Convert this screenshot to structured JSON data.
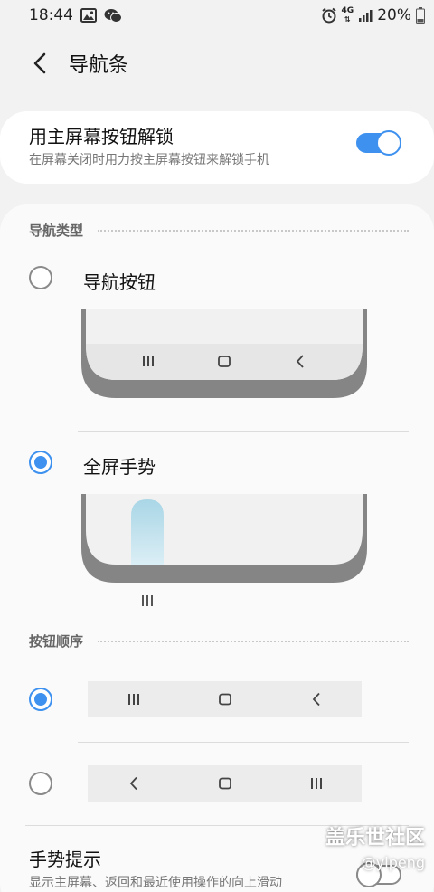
{
  "status_bar": {
    "time": "18:44",
    "network": "4G",
    "battery": "20%",
    "icons": [
      "image-icon",
      "wechat-icon",
      "alarm-icon",
      "network-4g-icon",
      "signal-icon",
      "battery-icon"
    ]
  },
  "header": {
    "title": "导航条",
    "back_icon": "back-arrow-icon"
  },
  "unlock_setting": {
    "title": "用主屏幕按钮解锁",
    "subtitle": "在屏幕关闭时用力按主屏幕按钮来解锁手机",
    "enabled": true
  },
  "nav_type": {
    "section_label": "导航类型",
    "options": [
      {
        "label": "导航按钮",
        "selected": false
      },
      {
        "label": "全屏手势",
        "selected": true
      }
    ]
  },
  "button_order": {
    "section_label": "按钮顺序",
    "options": [
      {
        "order": [
          "recents",
          "home",
          "back"
        ],
        "selected": true
      },
      {
        "order": [
          "back",
          "home",
          "recents"
        ],
        "selected": false
      }
    ]
  },
  "gesture_hint": {
    "title": "手势提示",
    "subtitle": "显示主屏幕、返回和最近使用操作的向上滑动",
    "enabled": false
  },
  "watermark": {
    "title": "盖乐世社区",
    "author": "@yipeng"
  },
  "colors": {
    "accent": "#3e91ef",
    "background": "#f2f2f2",
    "card": "#ffffff"
  }
}
